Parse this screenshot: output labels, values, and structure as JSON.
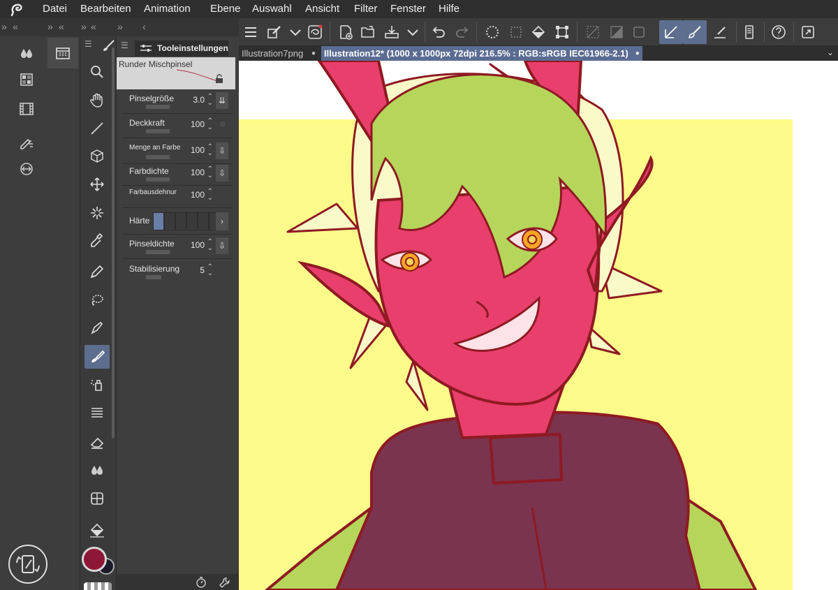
{
  "menu": {
    "items": [
      "Datei",
      "Bearbeiten",
      "Animation",
      "Ebene",
      "Auswahl",
      "Ansicht",
      "Filter",
      "Fenster",
      "Hilfe"
    ]
  },
  "toolbar": {
    "icons": [
      "menu-icon",
      "pen-pressure-icon",
      "chevron-down-icon",
      "reference-icon",
      "new-canvas-icon",
      "open-folder-icon",
      "save-icon",
      "chevron-down-icon",
      "undo-icon",
      "redo-icon",
      "select-all-icon",
      "deselect-icon",
      "fill-icon",
      "transform-icon",
      "snap-ruler-icon",
      "snap-special-icon",
      "snap-grid-icon",
      "ruler-pen-icon",
      "stroke-brush-icon",
      "eyedropper-stroke-icon",
      "smartphone-icon",
      "help-icon",
      "fullscreen-icon"
    ]
  },
  "tool_settings": {
    "tab_label": "Tooleinstellungen",
    "brush_name": "Runder Mischpinsel",
    "params": [
      {
        "label": "Pinselgröße",
        "value": "3.0"
      },
      {
        "label": "Deckkraft",
        "value": "100"
      },
      {
        "label": "Menge an Farbe",
        "value": "100"
      },
      {
        "label": "Farbdichte",
        "value": "100"
      },
      {
        "label": "Farbausdehnung",
        "value": "100"
      },
      {
        "label": "Härte",
        "value": ""
      },
      {
        "label": "Pinseldichte",
        "value": "100"
      },
      {
        "label": "Stabilisierung",
        "value": "5"
      }
    ],
    "hardness_level": 1,
    "hardness_steps": 6
  },
  "documents": {
    "tabs": [
      {
        "label": "Illustration7png",
        "active": false
      },
      {
        "label": "Illustration12* (1000 x 1000px 72dpi 216.5% : RGB:sRGB IEC61966-2.1)",
        "active": true
      }
    ]
  },
  "colors": {
    "main": "#8e1636",
    "sub": "#1b1b2b",
    "accent": "#5b6c92",
    "canvas_bg": "#fdfb8a",
    "skin": "#e93f6c",
    "hair": "#b5d65a",
    "outline": "#8e1a22",
    "jacket": "#7a3450"
  }
}
